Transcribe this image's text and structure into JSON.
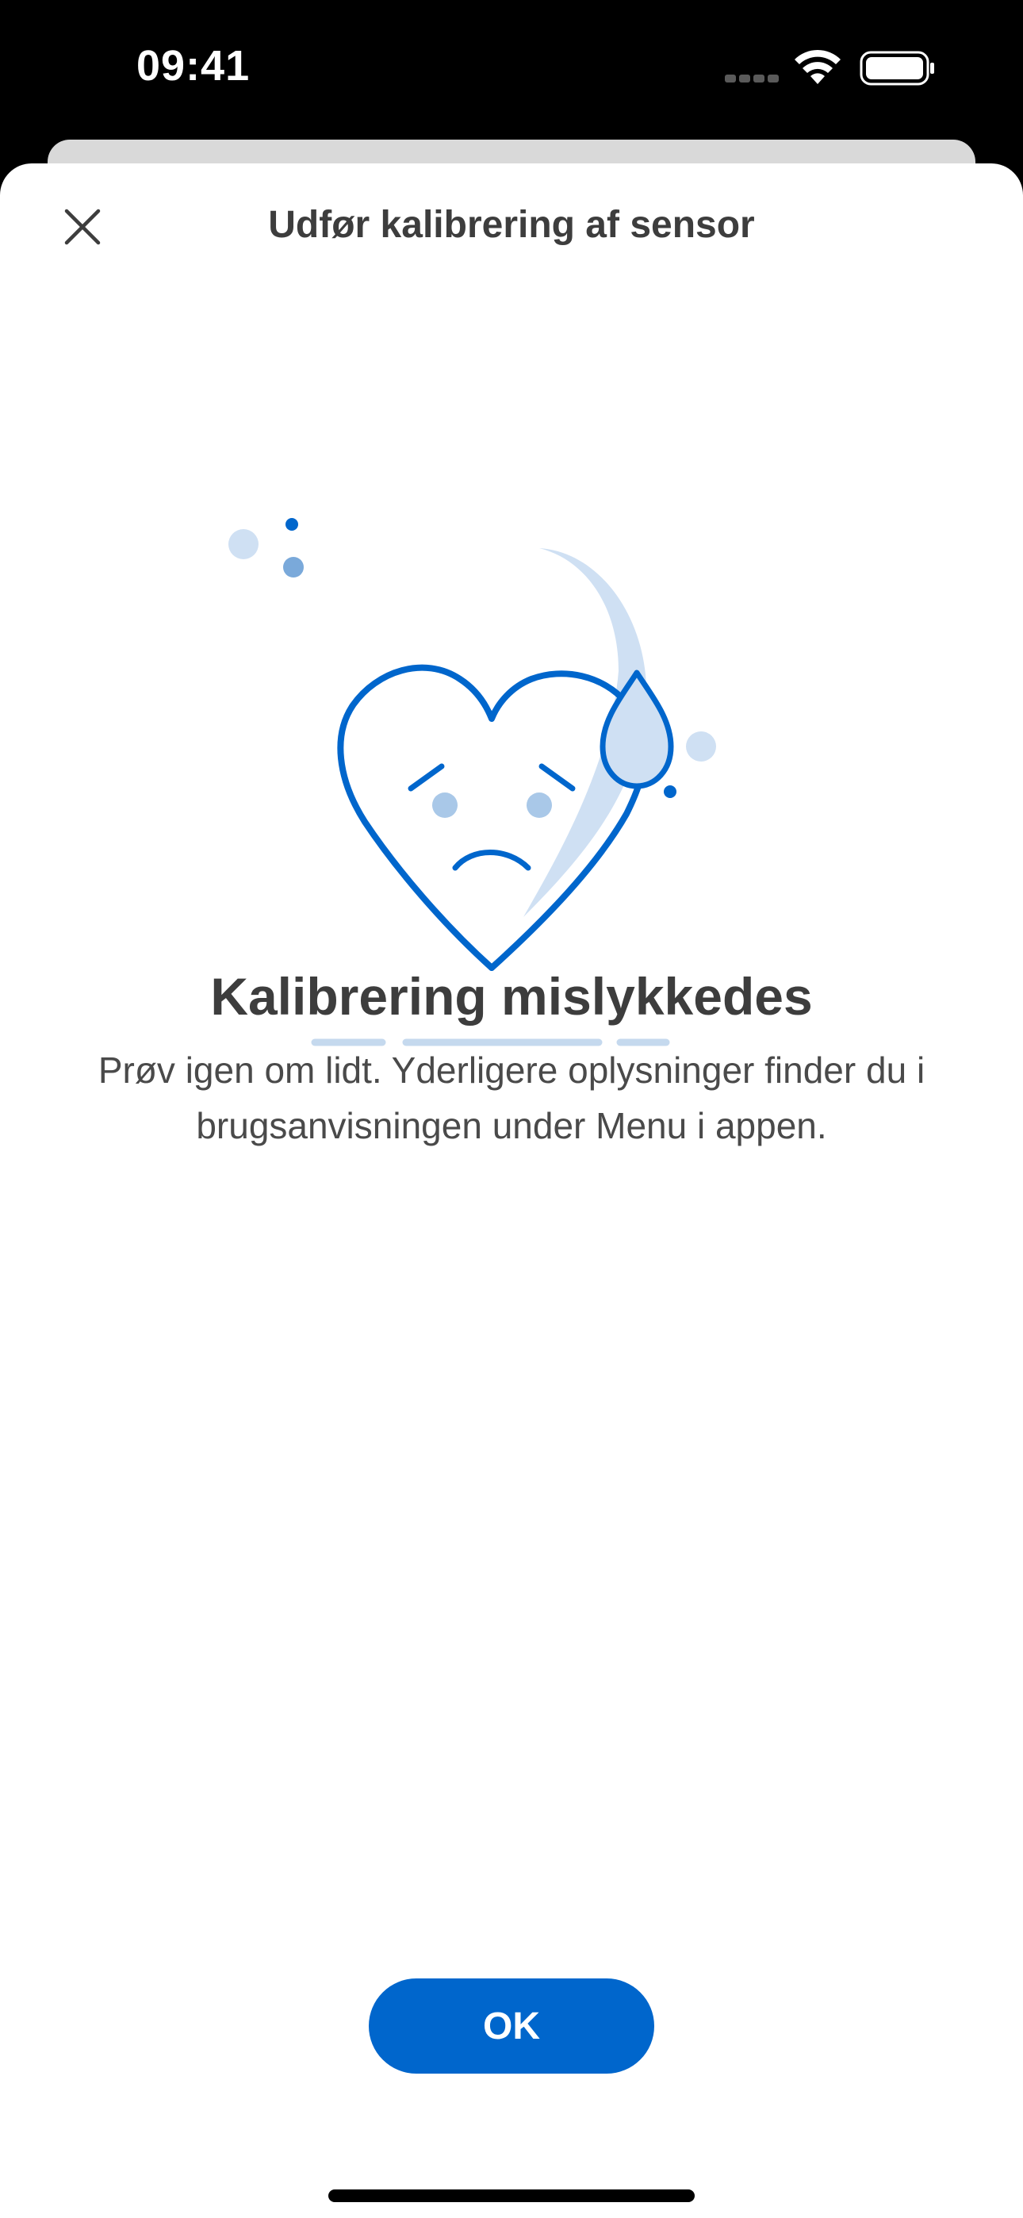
{
  "status_bar": {
    "time": "09:41",
    "icons": [
      "signal-icon",
      "wifi-icon",
      "battery-icon"
    ]
  },
  "header": {
    "title": "Udfør kalibrering af sensor",
    "close_icon": "close-icon"
  },
  "illustration": {
    "icon": "sad-heart-icon",
    "colors": {
      "primary": "#0066cc",
      "light": "#a9c8e8",
      "lighter": "#cfe0f3"
    }
  },
  "result": {
    "title": "Kalibrering mislykkedes",
    "body": "Prøv igen om lidt. Yderligere oplysninger finder du i brugsanvisningen under Menu i appen."
  },
  "actions": {
    "ok_label": "OK"
  },
  "colors": {
    "accent": "#0066cc",
    "text_dark": "#3d3d3d"
  }
}
